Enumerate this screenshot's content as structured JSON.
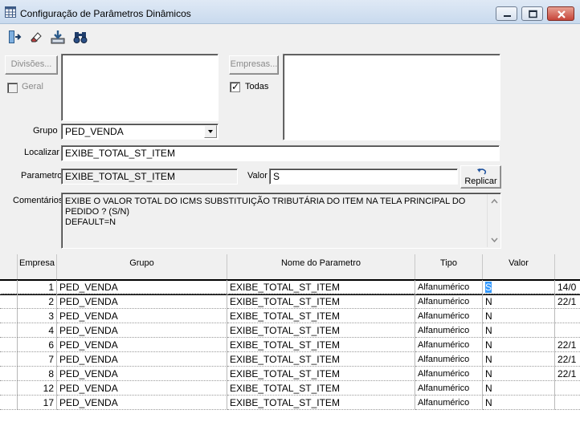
{
  "window": {
    "title": "Configuração de Parâmetros Dinâmicos"
  },
  "toolbar": {
    "icons": [
      "exit-door-icon",
      "eraser-icon",
      "save-download-icon",
      "binoculars-icon"
    ]
  },
  "filters": {
    "divisoes_button": "Divisões...",
    "geral_label": "Geral",
    "geral_checked": false,
    "empresas_button": "Empresas...",
    "todas_label": "Todas",
    "todas_checked": true,
    "grupo_label": "Grupo",
    "grupo_value": "PED_VENDA",
    "localizar_label": "Localizar",
    "localizar_value": "EXIBE_TOTAL_ST_ITEM"
  },
  "detail": {
    "parametro_label": "Parametro",
    "parametro_value": "EXIBE_TOTAL_ST_ITEM",
    "valor_label": "Valor",
    "valor_value": "S",
    "replicar_button": "Replicar",
    "comentarios_label": "Comentários",
    "comentarios_lines": [
      "EXIBE O VALOR TOTAL DO ICMS SUBSTITUIÇÃO TRIBUTÁRIA DO ITEM NA TELA PRINCIPAL DO",
      "PEDIDO ? (S/N)",
      "DEFAULT=N"
    ]
  },
  "grid": {
    "columns": [
      "Empresa",
      "Grupo",
      "Nome do Parametro",
      "Tipo",
      "Valor",
      ""
    ],
    "rows": [
      {
        "empresa": "1",
        "grupo": "PED_VENDA",
        "nome": "EXIBE_TOTAL_ST_ITEM",
        "tipo": "Alfanumérico",
        "valor": "S",
        "extra": "14/0"
      },
      {
        "empresa": "2",
        "grupo": "PED_VENDA",
        "nome": "EXIBE_TOTAL_ST_ITEM",
        "tipo": "Alfanumérico",
        "valor": "N",
        "extra": "22/1"
      },
      {
        "empresa": "3",
        "grupo": "PED_VENDA",
        "nome": "EXIBE_TOTAL_ST_ITEM",
        "tipo": "Alfanumérico",
        "valor": "N",
        "extra": ""
      },
      {
        "empresa": "4",
        "grupo": "PED_VENDA",
        "nome": "EXIBE_TOTAL_ST_ITEM",
        "tipo": "Alfanumérico",
        "valor": "N",
        "extra": ""
      },
      {
        "empresa": "6",
        "grupo": "PED_VENDA",
        "nome": "EXIBE_TOTAL_ST_ITEM",
        "tipo": "Alfanumérico",
        "valor": "N",
        "extra": "22/1"
      },
      {
        "empresa": "7",
        "grupo": "PED_VENDA",
        "nome": "EXIBE_TOTAL_ST_ITEM",
        "tipo": "Alfanumérico",
        "valor": "N",
        "extra": "22/1"
      },
      {
        "empresa": "8",
        "grupo": "PED_VENDA",
        "nome": "EXIBE_TOTAL_ST_ITEM",
        "tipo": "Alfanumérico",
        "valor": "N",
        "extra": "22/1"
      },
      {
        "empresa": "12",
        "grupo": "PED_VENDA",
        "nome": "EXIBE_TOTAL_ST_ITEM",
        "tipo": "Alfanumérico",
        "valor": "N",
        "extra": ""
      },
      {
        "empresa": "17",
        "grupo": "PED_VENDA",
        "nome": "EXIBE_TOTAL_ST_ITEM",
        "tipo": "Alfanumérico",
        "valor": "N",
        "extra": ""
      }
    ],
    "selected_row": 0
  },
  "colors": {
    "selection": "#3399ff",
    "titlebar": "#c9daee",
    "close_button": "#c6453a"
  }
}
